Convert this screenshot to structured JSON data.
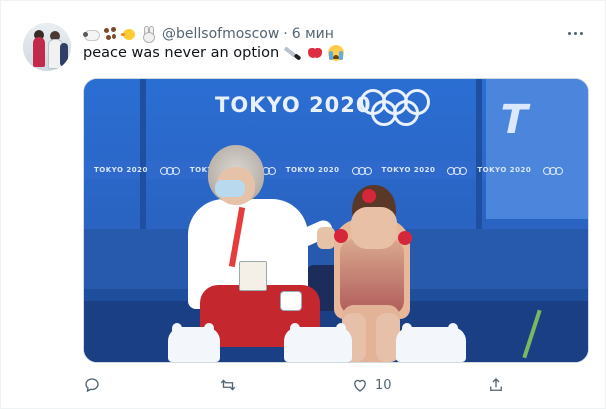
{
  "tweet": {
    "display_emojis": [
      "sheep",
      "paw-prints",
      "chick",
      "rabbit"
    ],
    "handle": "@bellsofmoscow",
    "separator": "·",
    "time": "6 мин",
    "text": "peace was never an option",
    "text_emojis": [
      "knife",
      "broken-heart",
      "loudly-crying-face"
    ]
  },
  "media": {
    "wall_text": "TOKYO 2020",
    "band_text": "TOKYO 2020",
    "panel_text": "T"
  },
  "actions": {
    "reply_icon": "reply-icon",
    "retweet_icon": "retweet-icon",
    "like_icon": "heart-icon",
    "like_count": "10",
    "share_icon": "share-icon"
  },
  "colors": {
    "text_primary": "#0f1419",
    "text_secondary": "#536471",
    "arena_blue": "#2b6ed3"
  }
}
